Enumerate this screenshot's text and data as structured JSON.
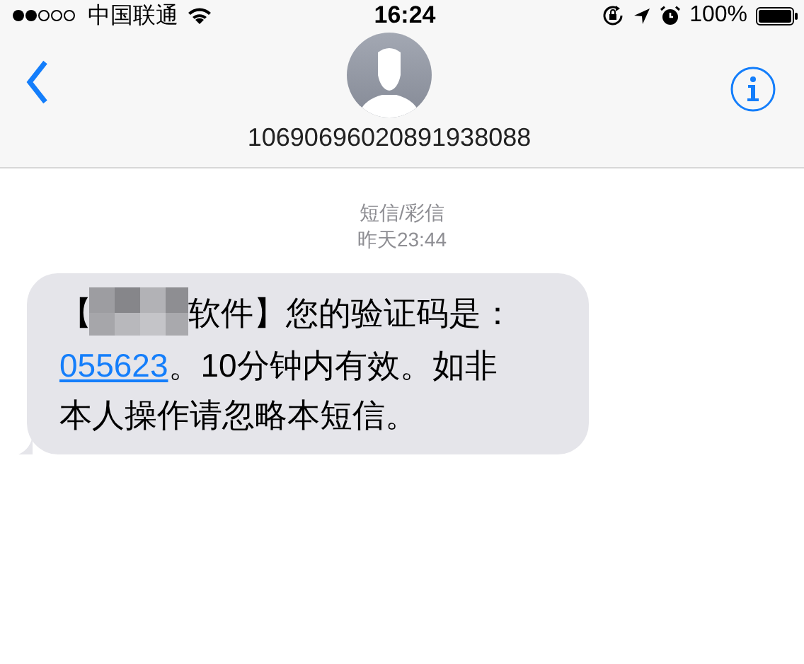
{
  "status_bar": {
    "carrier": "中国联通",
    "time": "16:24",
    "battery": "100%"
  },
  "header": {
    "contact": "10690696020891938088"
  },
  "thread": {
    "service": "短信/彩信",
    "timestamp": "昨天23:44"
  },
  "message": {
    "prefix": "【",
    "after_redaction": "软件】您的验证码是：",
    "code": "055623",
    "code_rest": "。10分钟内有效。如非",
    "last_line": "本人操作请忽略本短信。"
  }
}
